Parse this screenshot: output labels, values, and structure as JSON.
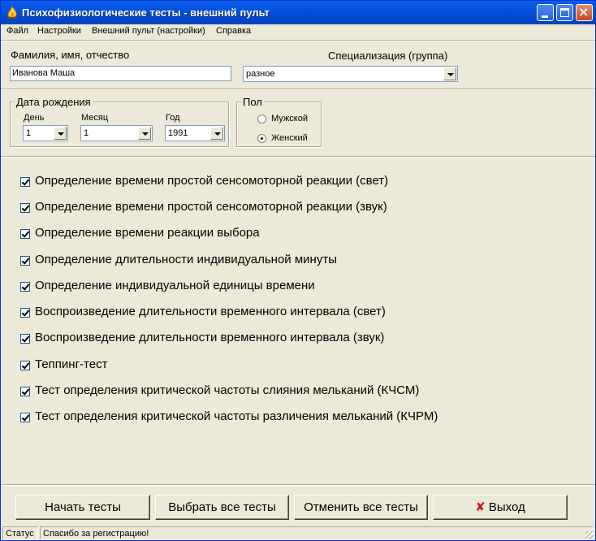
{
  "window": {
    "title": "Психофизиологические тесты - внешний пульт"
  },
  "menu": [
    "Файл",
    "Настройки",
    "Внешний пульт (настройки)",
    "Справка"
  ],
  "form": {
    "name_label": "Фамилия, имя, отчество",
    "name_value": "Иванова Маша",
    "spec_label": "Специализация (группа)",
    "spec_value": "разное"
  },
  "birth": {
    "group_title": "Дата рождения",
    "day_label": "День",
    "day_value": "1",
    "month_label": "Месяц",
    "month_value": "1",
    "year_label": "Год",
    "year_value": "1991"
  },
  "gender": {
    "group_title": "Пол",
    "male": "Мужской",
    "female": "Женский",
    "selected": "Женский"
  },
  "tests": [
    {
      "label": "Определение времени простой сенсомоторной реакции (свет)",
      "checked": true
    },
    {
      "label": "Определение времени простой сенсомоторной реакции (звук)",
      "checked": true
    },
    {
      "label": "Определение времени реакции выбора",
      "checked": true
    },
    {
      "label": "Определение длительности индивидуальной минуты",
      "checked": true
    },
    {
      "label": "Определение индивидуальной единицы времени",
      "checked": true
    },
    {
      "label": "Воспроизведение длительности временного интервала (свет)",
      "checked": true
    },
    {
      "label": "Воспроизведение длительности временного интервала (звук)",
      "checked": true
    },
    {
      "label": "Теппинг-тест",
      "checked": true
    },
    {
      "label": "Тест определения критической частоты слияния мельканий (КЧСМ)",
      "checked": true
    },
    {
      "label": "Тест определения критической частоты различения мельканий (КЧРМ)",
      "checked": true
    }
  ],
  "buttons": {
    "start": "Начать тесты",
    "select_all": "Выбрать все тесты",
    "cancel_all": "Отменить все тесты",
    "exit": "Выход",
    "exit_icon": "✘"
  },
  "status": {
    "label": "Статус",
    "message": "Спасибо за регистрацию!"
  }
}
